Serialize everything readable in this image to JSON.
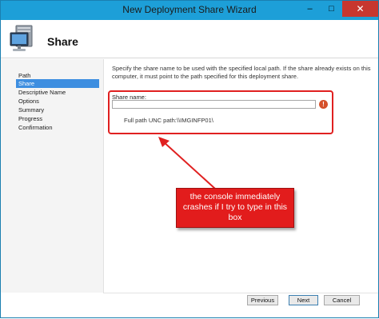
{
  "window": {
    "title": "New Deployment Share Wizard",
    "controls": {
      "minimize": "–",
      "maximize": "□",
      "close": "✕"
    }
  },
  "header": {
    "title": "Share",
    "icon": "computer-icon"
  },
  "nav": {
    "items": [
      {
        "label": "Path",
        "selected": false
      },
      {
        "label": "Share",
        "selected": true
      },
      {
        "label": "Descriptive Name",
        "selected": false
      },
      {
        "label": "Options",
        "selected": false
      },
      {
        "label": "Summary",
        "selected": false
      },
      {
        "label": "Progress",
        "selected": false
      },
      {
        "label": "Confirmation",
        "selected": false
      }
    ]
  },
  "content": {
    "description": "Specify the share name to be used with the specified local path.  If the share already exists on this computer, it must point to the path specified for this deployment share.",
    "share_name_label": "Share name:",
    "share_name_value": "",
    "error_icon": "!",
    "unc_label": "Full path UNC path:",
    "unc_value": "\\\\IMGINFP01\\"
  },
  "annotation": {
    "text": "the console immediately crashes if I try to type in this box",
    "color": "#e21c1c"
  },
  "footer": {
    "previous": "Previous",
    "next": "Next",
    "cancel": "Cancel"
  },
  "colors": {
    "titlebar": "#1d9fd8",
    "selection": "#3d8ee0",
    "close": "#c7372f"
  }
}
